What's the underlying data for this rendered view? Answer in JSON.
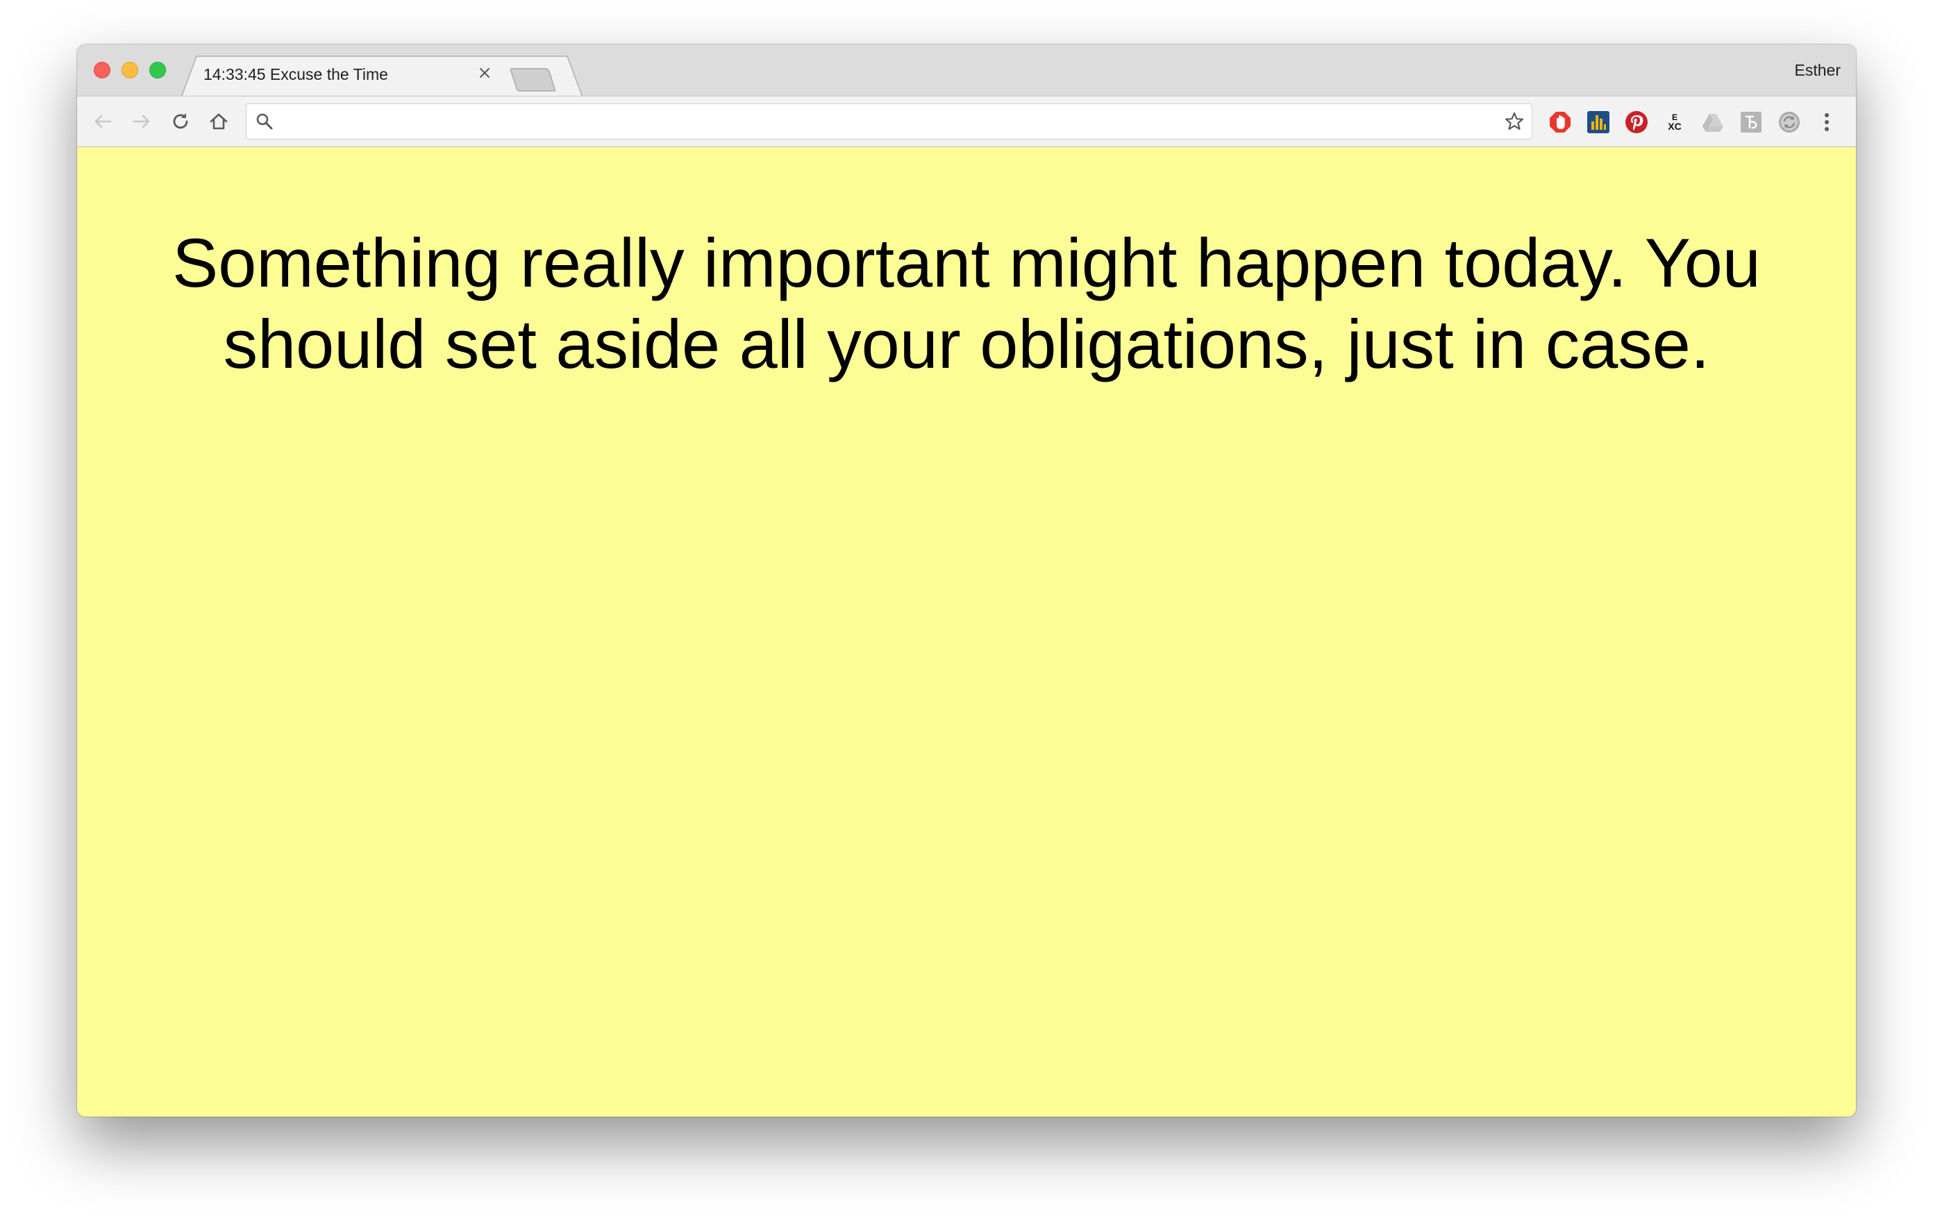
{
  "browser": {
    "tab": {
      "title": "14:33:45 Excuse the Time",
      "close_icon": "close-icon"
    },
    "profile_name": "Esther",
    "address_bar": {
      "value": "",
      "placeholder": ""
    },
    "extensions": [
      "adblock-icon",
      "analytics-icon",
      "pinterest-icon",
      "exc-icon",
      "drive-icon",
      "kana-icon",
      "sync-icon"
    ],
    "extension_labels": {
      "exc_top": "E",
      "exc_bottom": "XC"
    }
  },
  "page": {
    "background_color": "#fdfd96",
    "message": "Something really important might happen today. You should set aside all your obligations, just in case."
  }
}
